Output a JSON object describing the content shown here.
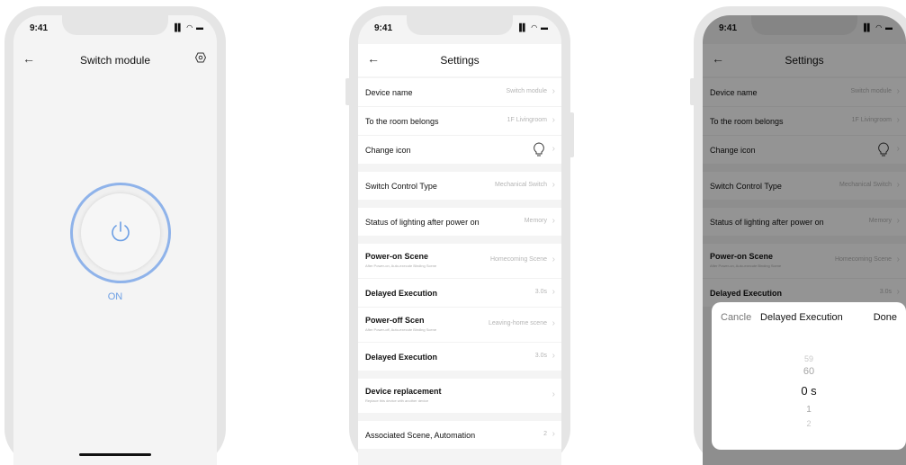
{
  "status_bar": {
    "time": "9:41",
    "icons": "▐▌ ◠ ▬"
  },
  "screen1": {
    "nav": {
      "back": "←",
      "title": "Switch module"
    },
    "power_state": "ON",
    "accent_color": "#8fb3ea"
  },
  "screen2": {
    "nav": {
      "back": "←",
      "title": "Settings"
    },
    "groups": [
      [
        {
          "label": "Device name",
          "value": "Switch module"
        },
        {
          "label": "To the room belongs",
          "value": "1F Livingroom"
        },
        {
          "label": "Change icon",
          "icon": "lightbulb-icon"
        }
      ],
      [
        {
          "label": "Switch Control Type",
          "value": "Mechanical Switch"
        }
      ],
      [
        {
          "label": "Status of lighting after power on",
          "value": "Memory"
        }
      ],
      [
        {
          "label": "Power-on Scene",
          "sub": "After Power-on, Auto-execute Binding Scene",
          "value": "Homecoming Scene"
        },
        {
          "label": "Delayed Execution",
          "value": "3.0s"
        },
        {
          "label": "Power-off Scen",
          "sub": "After Power-off, Auto-execute Binding Scene",
          "value": "Leaving-home scene"
        },
        {
          "label": "Delayed Execution",
          "value": "3.0s"
        }
      ],
      [
        {
          "label": "Device replacement",
          "sub": "Replace this device with another device",
          "value": ""
        }
      ],
      [
        {
          "label": "Associated Scene, Automation",
          "value": "2"
        }
      ]
    ]
  },
  "screen3": {
    "sheet": {
      "cancel": "Cancle",
      "title": "Delayed Execution",
      "done": "Done",
      "picker": [
        "59",
        "60",
        "0 s",
        "1",
        "2"
      ]
    }
  }
}
